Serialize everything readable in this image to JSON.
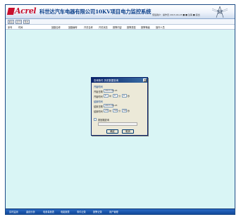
{
  "header": {
    "brand": "Acrel",
    "title": "科世达汽车电器有限公司10KV项目电力监控系统",
    "user_info": "值班用户：操作员  2013-04-23  ■ ■ 注销 ■ 退出"
  },
  "toolbar": {
    "buttons": [
      "报表",
      "打印",
      "导出"
    ]
  },
  "table": {
    "columns": [
      "序号",
      "时间",
      "回路名称",
      "回路编号",
      "开关名称",
      "开关状态",
      "报警内容",
      "报警类型",
      "报警等级",
      "操作人员"
    ]
  },
  "dialog": {
    "title": "查询条件     历史数据查询",
    "close": "×",
    "group_start": "开始时间",
    "group_end": "结束时间",
    "start_date_label": "开始日期",
    "start_date_value": "2013-04-23",
    "start_time_label": "开始时间",
    "end_date_label": "结束日期",
    "end_date_value": "2013-04-23",
    "end_time_label": "结束时间",
    "start_time": {
      "hour": "0",
      "minute": "0",
      "second": "0"
    },
    "end_time": {
      "hour": "23",
      "minute": "59",
      "second": "59"
    },
    "units": {
      "hour": "时",
      "minute": "分",
      "second": "秒"
    },
    "checkbox_label": "按回路查询",
    "ok": "确定",
    "cancel": "取消"
  },
  "bottom_nav": {
    "items": [
      "实时监测",
      "曲线分析",
      "电参量报表",
      "电能报表",
      "事件记录",
      "报警记录",
      "用户管理"
    ]
  },
  "colors": {
    "brand_red": "#c8102e",
    "title_blue": "#0a3f8a",
    "content_bg": "#d9f5f5",
    "bottom_bar": "#11489a"
  }
}
